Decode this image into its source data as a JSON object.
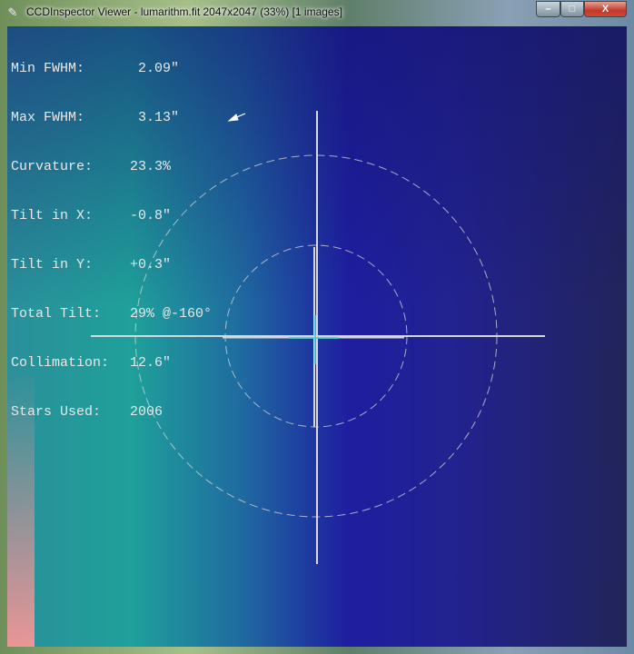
{
  "window": {
    "title": "CCDInspector Viewer - lumarithm.fit 2047x2047 (33%)  [1 images]",
    "controls": {
      "minimize": "–",
      "maximize": "□",
      "close": "X"
    }
  },
  "stats": [
    {
      "label": "Min FWHM:",
      "value": " 2.09\""
    },
    {
      "label": "Max FWHM:",
      "value": " 3.13\""
    },
    {
      "label": "Curvature:",
      "value": "23.3%"
    },
    {
      "label": "Tilt in X:",
      "value": "-0.8\""
    },
    {
      "label": "Tilt in Y:",
      "value": "+0.3\""
    },
    {
      "label": "Total Tilt:",
      "value": "29% @-160°"
    },
    {
      "label": "Collimation:",
      "value": "12.6\""
    },
    {
      "label": "Stars Used:",
      "value": "2006"
    }
  ]
}
